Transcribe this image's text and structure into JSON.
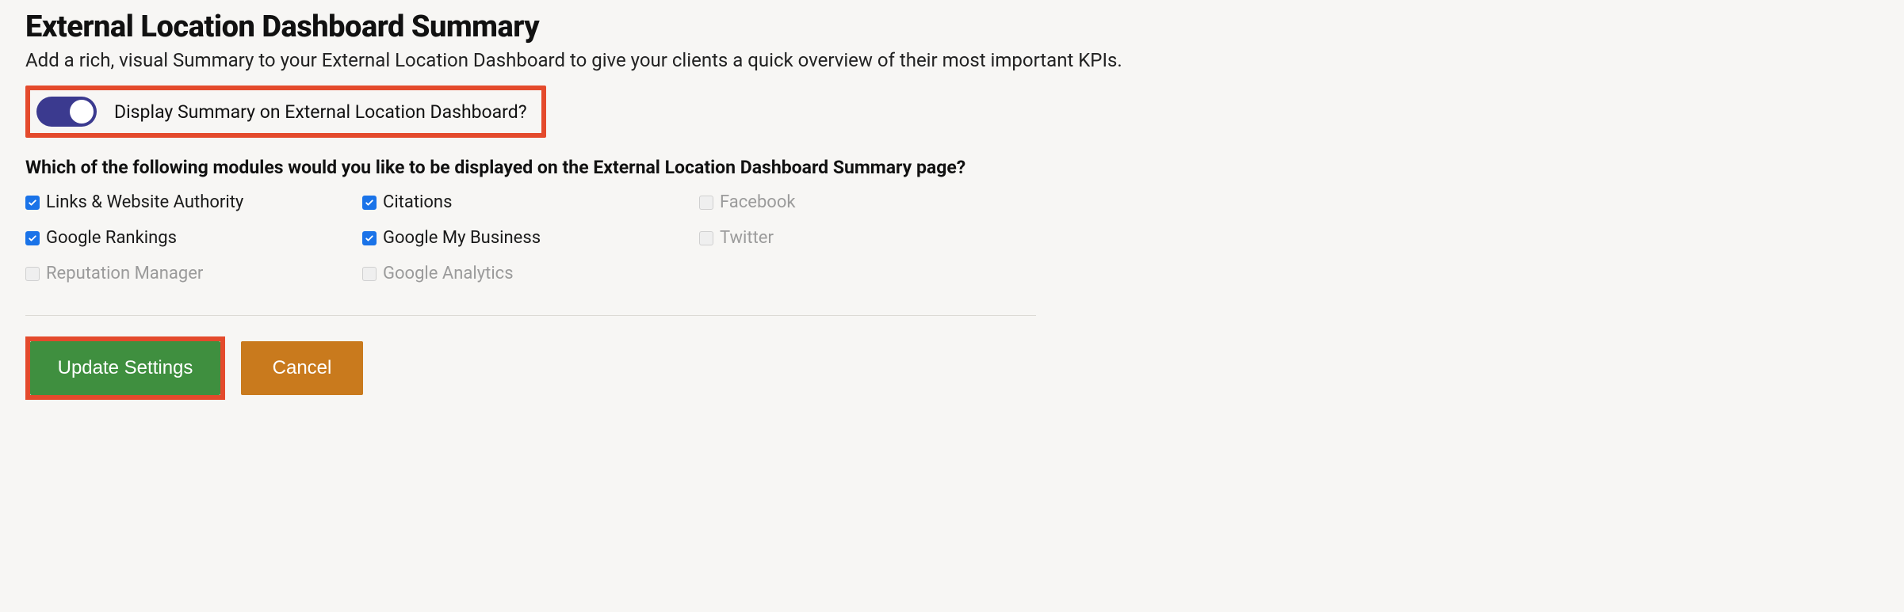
{
  "header": {
    "title": "External Location Dashboard Summary",
    "subtitle": "Add a rich, visual Summary to your External Location Dashboard to give your clients a quick overview of their most important KPIs."
  },
  "toggle": {
    "label": "Display Summary on External Location Dashboard?",
    "on": true
  },
  "modules": {
    "question": "Which of the following modules would you like to be displayed on the External Location Dashboard Summary page?",
    "items": [
      {
        "key": "links-authority",
        "label": "Links & Website Authority",
        "checked": true,
        "disabled": false
      },
      {
        "key": "citations",
        "label": "Citations",
        "checked": true,
        "disabled": false
      },
      {
        "key": "facebook",
        "label": "Facebook",
        "checked": false,
        "disabled": true
      },
      {
        "key": "google-rankings",
        "label": "Google Rankings",
        "checked": true,
        "disabled": false
      },
      {
        "key": "gmb",
        "label": "Google My Business",
        "checked": true,
        "disabled": false
      },
      {
        "key": "twitter",
        "label": "Twitter",
        "checked": false,
        "disabled": true
      },
      {
        "key": "reputation",
        "label": "Reputation Manager",
        "checked": false,
        "disabled": true
      },
      {
        "key": "ga",
        "label": "Google Analytics",
        "checked": false,
        "disabled": true
      }
    ]
  },
  "actions": {
    "update_label": "Update Settings",
    "cancel_label": "Cancel"
  }
}
